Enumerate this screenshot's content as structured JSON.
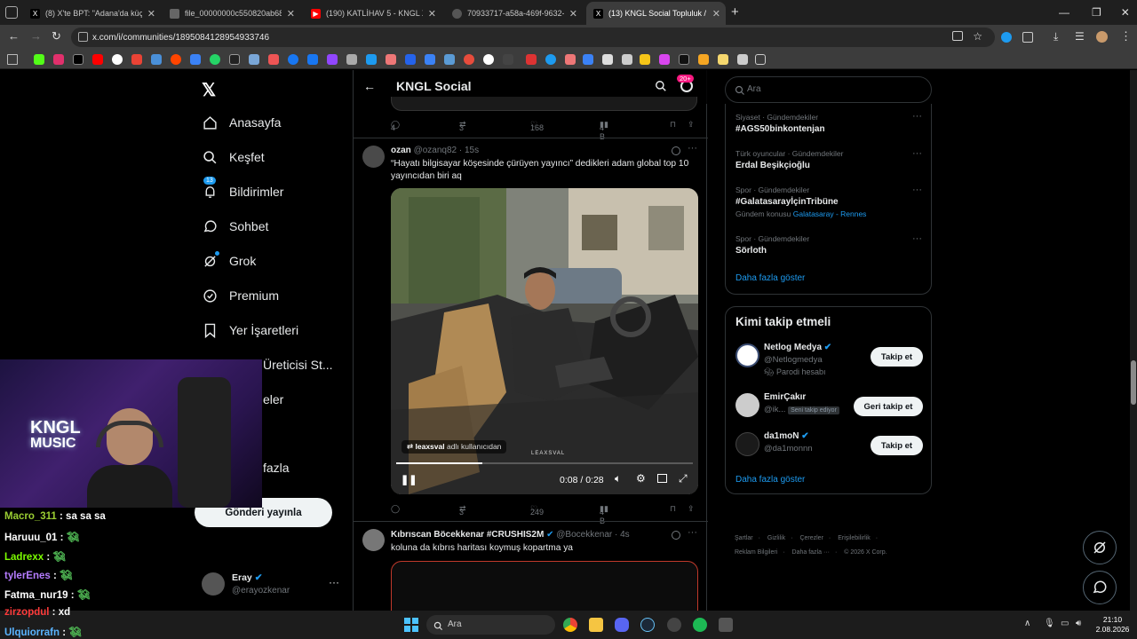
{
  "browser": {
    "tabs": [
      {
        "title": "(8) X'te BPT: \"Adana'da küçük y",
        "color": "#000"
      },
      {
        "title": "file_00000000c550820ab68ca3",
        "color": "#555"
      },
      {
        "title": "(190) KATLİHAV 5 - KNGL X ER",
        "color": "#ff0000"
      },
      {
        "title": "70933717-a58a-469f-9632-dca",
        "color": "#666"
      },
      {
        "title": "(13) KNGL Social Topluluk /",
        "color": "#000"
      }
    ],
    "new_tab": "+",
    "url": "x.com/i/communities/1895084128954933746"
  },
  "sidebar": {
    "items": [
      {
        "label": "Anasayfa",
        "icon": "home-icon"
      },
      {
        "label": "Keşfet",
        "icon": "search-icon"
      },
      {
        "label": "Bildirimler",
        "icon": "bell-icon",
        "badge": "13"
      },
      {
        "label": "Sohbet",
        "icon": "chat-icon"
      },
      {
        "label": "Grok",
        "icon": "grok-icon"
      },
      {
        "label": "Premium",
        "icon": "premium-icon"
      },
      {
        "label": "Yer İşaretleri",
        "icon": "bookmark-icon"
      },
      {
        "label": "Üreticisi St...",
        "icon": "creator-icon"
      },
      {
        "label": "eler",
        "icon": "list-icon"
      },
      {
        "label": "fazla",
        "icon": "more-icon"
      }
    ],
    "post_button": "Gönderi yayınla",
    "account": {
      "name": "Eray",
      "handle": "@erayozkenar"
    }
  },
  "header": {
    "title": "KNGL Social",
    "badge": "20+"
  },
  "top_actions": {
    "replies": "4",
    "reposts": "3",
    "likes": "168",
    "views": "4 B"
  },
  "tweet1": {
    "name": "ozan",
    "handle": "@ozanq82 · 15s",
    "text_line1": "“Hayatı bilgisayar köşesinde çürüyen yayıncı” dedikleri adam global top 10",
    "text_line2": "yayıncıdan biri aq",
    "video_attribution_user": "leaxsval",
    "video_attribution_text": "adlı kullanıcıdan",
    "watermark": "LEAXSVAL",
    "time": "0:08 / 0:28",
    "progress": 0.29,
    "replies": "",
    "reposts": "3",
    "likes": "249",
    "views": "4 B"
  },
  "tweet2": {
    "name": "Kıbrıscan Böcekkenar #CRUSHIS2M",
    "handle": "@Bocekkenar · 4s",
    "text": "koluna da kıbrıs haritası koymuş kopartma ya"
  },
  "search": {
    "placeholder": "Ara"
  },
  "trends": [
    {
      "category": "Siyaset · Gündemdekiler",
      "name": "#AGS50binkontenjan"
    },
    {
      "category": "Türk oyuncular · Gündemdekiler",
      "name": "Erdal Beşikçioğlu"
    },
    {
      "category": "Spor · Gündemdekiler",
      "name": "#GalatasarayİçinTribüne",
      "extra_prefix": "Gündem konusu",
      "extra_link": "Galatasaray - Rennes"
    },
    {
      "category": "Spor · Gündemdekiler",
      "name": "Sörloth"
    }
  ],
  "show_more": "Daha fazla göster",
  "who_to_follow": {
    "title": "Kimi takip etmeli",
    "users": [
      {
        "name": "Netlog Medya",
        "handle": "@Netlogmedya",
        "note": "Parodi hesabı",
        "button": "Takip et"
      },
      {
        "name": "EmirÇakır",
        "handle": "@ik...",
        "note": "Seni takip ediyor",
        "button": "Geri takip et"
      },
      {
        "name": "da1moN",
        "handle": "@da1monnn",
        "note": "",
        "button": "Takip et"
      }
    ],
    "show_more": "Daha fazla göster"
  },
  "footer": {
    "links1": [
      "Şartlar",
      "Gizlilik",
      "Çerezler",
      "Erişilebilirlik"
    ],
    "links2": [
      "Reklam Bilgileri",
      "Daha fazla ···",
      "© 2026 X Corp."
    ]
  },
  "chat": [
    {
      "user": "Macro_311",
      "msg": ": sa sa sa",
      "color": "#9acd32"
    },
    {
      "user": "Haruuu_01",
      "msg": ":",
      "color": "#ffffff"
    },
    {
      "user": "Ladrexx",
      "msg": ":",
      "color": "#7cfc00"
    },
    {
      "user": "tylerEnes",
      "msg": ":",
      "color": "#b57cff"
    },
    {
      "user": "Fatma_nur19",
      "msg": ":",
      "color": "#ffffff"
    },
    {
      "user": "zirzopdul",
      "msg": ": xd",
      "color": "#ff3b3b"
    },
    {
      "user": "Ulquiorrafn",
      "msg": ":",
      "color": "#5ab4ff"
    }
  ],
  "webcam": {
    "logo_line1": "KNGL",
    "logo_line2": "MUSIC"
  },
  "taskbar": {
    "search": "Ara",
    "time": "21:10",
    "date": "2.08.2026"
  },
  "colors": {
    "accent": "#1d9bf0",
    "pink_badge": "#f91880",
    "verified": "#1d9bf0"
  }
}
